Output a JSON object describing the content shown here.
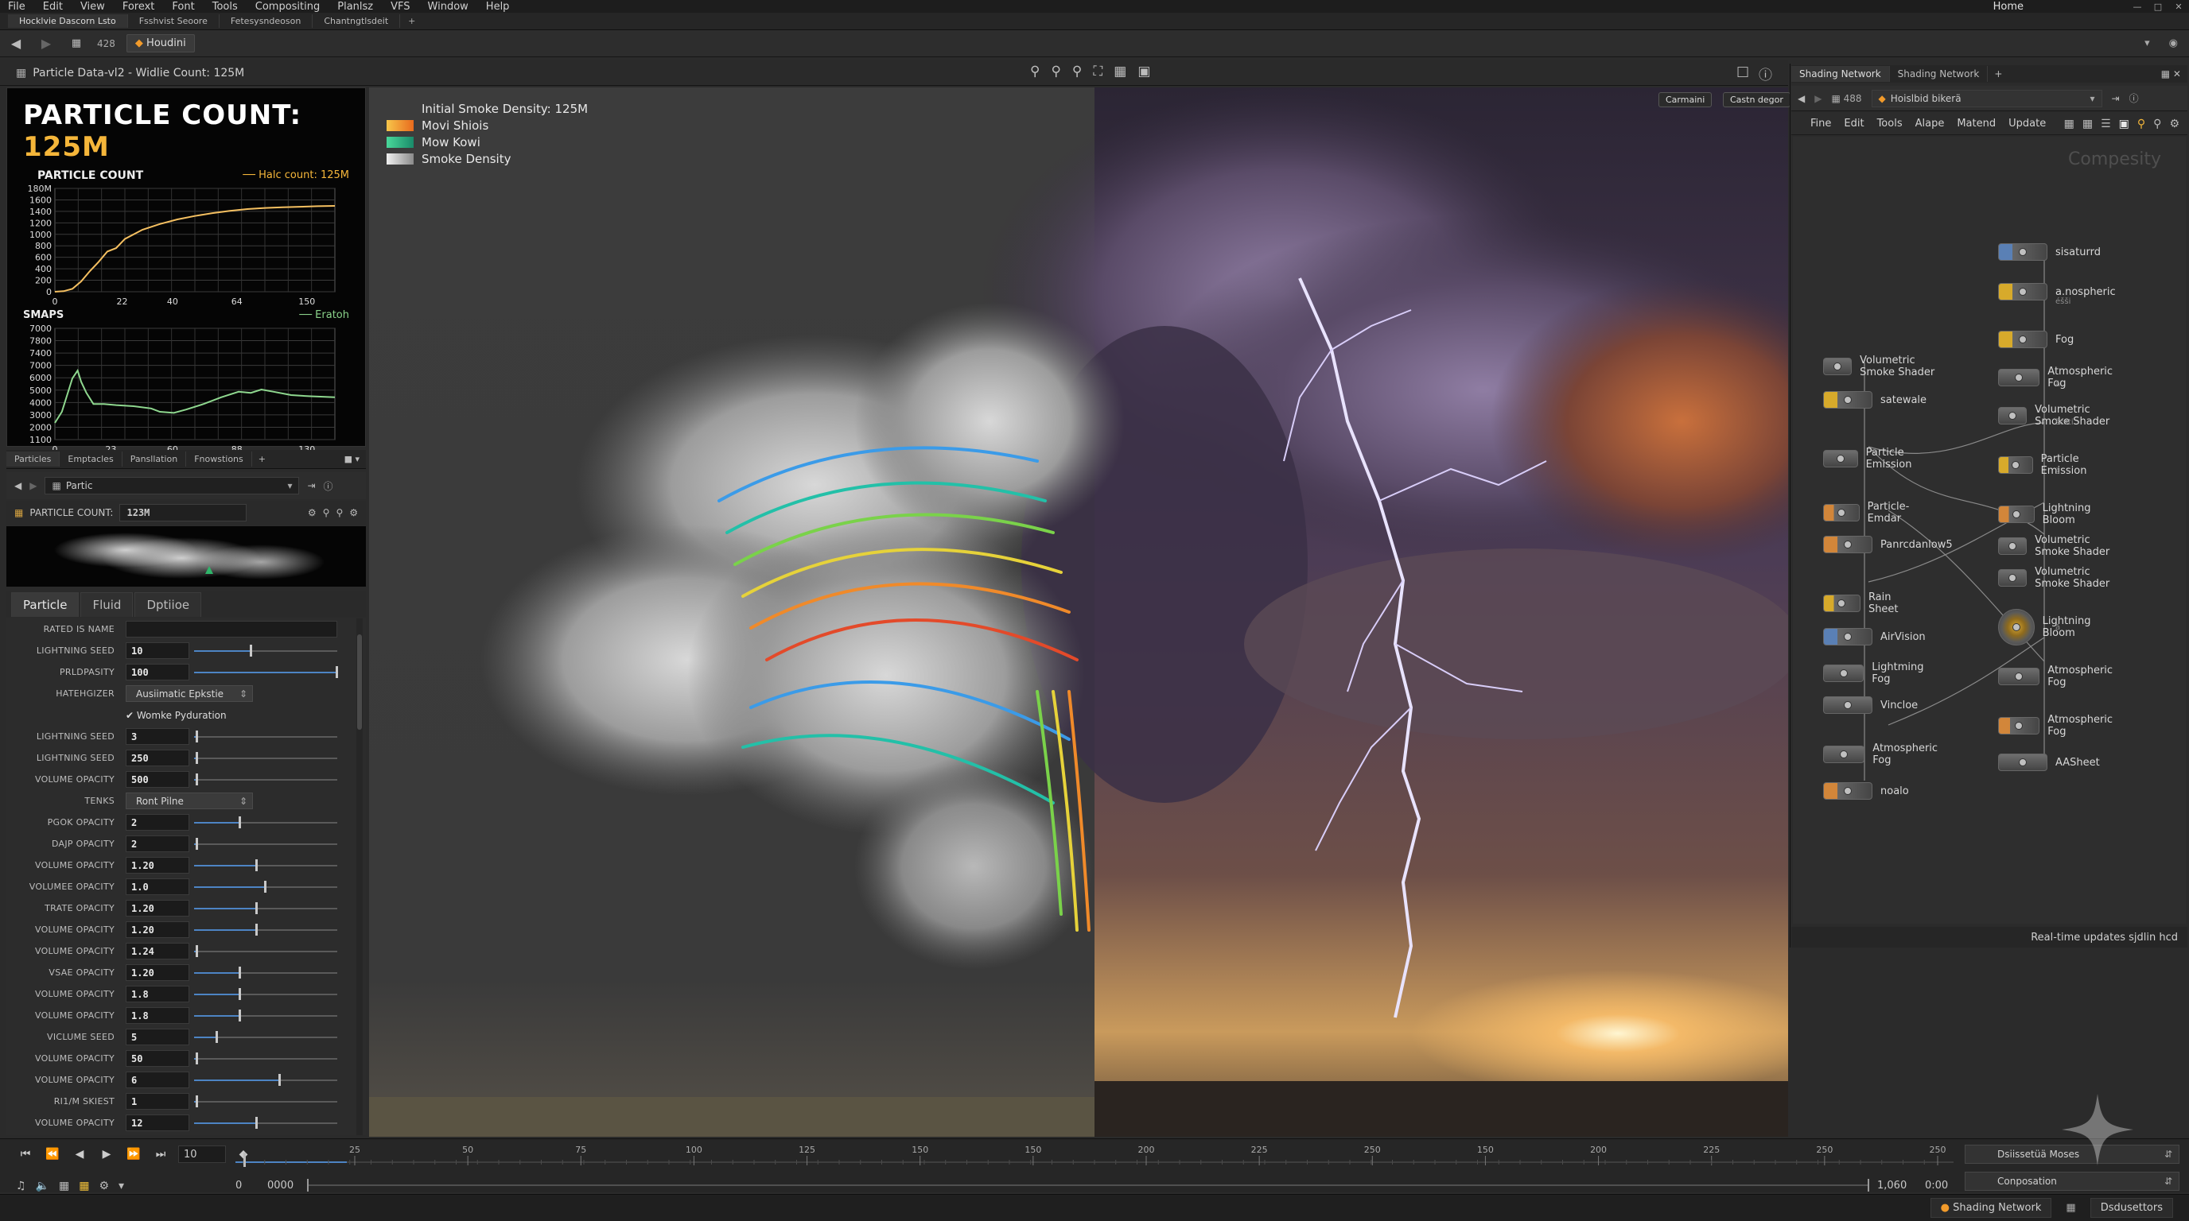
{
  "menubar": {
    "items": [
      "File",
      "Edit",
      "View",
      "Forext",
      "Font",
      "Tools",
      "Compositing",
      "Planlsz",
      "VFS",
      "Window",
      "Help"
    ],
    "desktop": "Home"
  },
  "tabstrip": {
    "tabs": [
      "Hocklvie Dascorn Lsto",
      "Fsshvist Seoore",
      "Fetesysndeoson",
      "Chantngtlsdeit"
    ]
  },
  "pathbar": {
    "node_chip": "428",
    "context_chip": "Houdini"
  },
  "viewport_header": {
    "title": "Particle Data-vl2 - Widlie Count:  125M"
  },
  "stats": {
    "heading_prefix": "PARTICLE COUNT:",
    "heading_value": "125M",
    "chart1": {
      "title": "PARTICLE COUNT",
      "legend": "Halc count: 125M"
    },
    "chart2": {
      "title": "SMAPS",
      "legend": "Eratoh"
    }
  },
  "chart_data": [
    {
      "type": "line",
      "title": "PARTICLE COUNT",
      "xlabel": "",
      "ylabel": "",
      "x_ticks": [
        "0",
        "22",
        "40",
        "64",
        "150"
      ],
      "y_ticks": [
        "0",
        "200",
        "400",
        "600",
        "800",
        "1000",
        "1200",
        "1400",
        "1600",
        "180M"
      ],
      "ylim": [
        0,
        1800
      ],
      "color": "#f5c061",
      "series": [
        {
          "name": "Halc count: 125M",
          "values": [
            [
              0,
              0
            ],
            [
              5,
              10
            ],
            [
              10,
              50
            ],
            [
              15,
              180
            ],
            [
              20,
              360
            ],
            [
              25,
              520
            ],
            [
              30,
              700
            ],
            [
              35,
              760
            ],
            [
              40,
              920
            ],
            [
              50,
              1080
            ],
            [
              60,
              1180
            ],
            [
              70,
              1260
            ],
            [
              80,
              1320
            ],
            [
              90,
              1370
            ],
            [
              100,
              1410
            ],
            [
              110,
              1440
            ],
            [
              120,
              1460
            ],
            [
              130,
              1470
            ],
            [
              140,
              1480
            ],
            [
              150,
              1490
            ],
            [
              160,
              1495
            ]
          ]
        }
      ],
      "xlim": [
        0,
        160
      ],
      "grid": true,
      "legend_position": "top-right"
    },
    {
      "type": "line",
      "title": "SMAPS",
      "xlabel": "",
      "ylabel": "",
      "x_ticks": [
        "0",
        "23",
        "60",
        "88",
        "130"
      ],
      "y_ticks": [
        "1100",
        "2000",
        "3000",
        "4000",
        "5000",
        "6000",
        "7000",
        "7400",
        "7800",
        "7000"
      ],
      "color": "#8fd88f",
      "series": [
        {
          "name": "Eratoh",
          "values": [
            [
              0,
              0.15
            ],
            [
              4,
              0.25
            ],
            [
              8,
              0.45
            ],
            [
              10,
              0.55
            ],
            [
              13,
              0.62
            ],
            [
              15,
              0.52
            ],
            [
              18,
              0.42
            ],
            [
              22,
              0.32
            ],
            [
              28,
              0.32
            ],
            [
              35,
              0.31
            ],
            [
              45,
              0.3
            ],
            [
              55,
              0.28
            ],
            [
              60,
              0.25
            ],
            [
              68,
              0.24
            ],
            [
              75,
              0.27
            ],
            [
              85,
              0.32
            ],
            [
              95,
              0.38
            ],
            [
              105,
              0.43
            ],
            [
              112,
              0.42
            ],
            [
              118,
              0.45
            ],
            [
              125,
              0.43
            ],
            [
              135,
              0.4
            ],
            [
              145,
              0.39
            ],
            [
              160,
              0.38
            ]
          ]
        }
      ],
      "xlim": [
        0,
        160
      ],
      "grid": true,
      "legend_position": "top-right"
    }
  ],
  "particles_panel": {
    "tabs": [
      "Particles",
      "Emptacles",
      "Pansllation",
      "Fnowstions"
    ],
    "path_value": "Partic",
    "count_label": "PARTICLE COUNT:",
    "count_value": "123M"
  },
  "param_tabs": [
    "Particle",
    "Fluid",
    "Dptiioe"
  ],
  "params": [
    {
      "label": "RATED IS NAME",
      "kind": "text",
      "value": ""
    },
    {
      "label": "LIGHTNING SEED",
      "kind": "num",
      "value": "10",
      "level": 0.4
    },
    {
      "label": "PRLDPASITY",
      "kind": "num",
      "value": "100",
      "level": 1.0
    },
    {
      "label": "HATEHGIZER",
      "kind": "menu",
      "value": "Ausiimatic Epkstie"
    },
    {
      "label": "",
      "kind": "check",
      "value": "Womke Pyduration"
    },
    {
      "label": "LIGHTNING SEED",
      "kind": "num",
      "value": "3",
      "level": 0.02
    },
    {
      "label": "LIGHTNING SEED",
      "kind": "num",
      "value": "250",
      "level": 0.02
    },
    {
      "label": "VOLUME OPACITY",
      "kind": "num",
      "value": "500",
      "level": 0.02
    },
    {
      "label": "TENKS",
      "kind": "menu",
      "value": "Ront Pilne"
    },
    {
      "label": "PGOK OPACITY",
      "kind": "num",
      "value": "2",
      "level": 0.32
    },
    {
      "label": "DAJP OPACITY",
      "kind": "num",
      "value": "2",
      "level": 0.02
    },
    {
      "label": "VOLUME OPACITY",
      "kind": "num",
      "value": "1.20",
      "level": 0.44
    },
    {
      "label": "VOLUMEE OPACITY",
      "kind": "num",
      "value": "1.0",
      "level": 0.5
    },
    {
      "label": "TRATE OPACITY",
      "kind": "num",
      "value": "1.20",
      "level": 0.44
    },
    {
      "label": "VOLUME OPACITY",
      "kind": "num",
      "value": "1.20",
      "level": 0.44
    },
    {
      "label": "VOLUME OPACITY",
      "kind": "num",
      "value": "1.24",
      "level": 0.02
    },
    {
      "label": "VSAE OPACITY",
      "kind": "num",
      "value": "1.20",
      "level": 0.32
    },
    {
      "label": "VOLUME OPACITY",
      "kind": "num",
      "value": "1.8",
      "level": 0.32
    },
    {
      "label": "VOLUME OPACITY",
      "kind": "num",
      "value": "1.8",
      "level": 0.32
    },
    {
      "label": "VICLUME SEED",
      "kind": "num",
      "value": "5",
      "level": 0.16
    },
    {
      "label": "VOLUME OPACITY",
      "kind": "num",
      "value": "50",
      "level": 0.02
    },
    {
      "label": "VOLUME OPACITY",
      "kind": "num",
      "value": "6",
      "level": 0.6
    },
    {
      "label": "RI1/M SKIEST",
      "kind": "num",
      "value": "1",
      "level": 0.02
    },
    {
      "label": "VOLUME OPACITY",
      "kind": "num",
      "value": "12",
      "level": 0.44
    }
  ],
  "viewport": {
    "legend": [
      {
        "label": "Initial Smoke Density: 125M",
        "color": ""
      },
      {
        "label": "Movi Shiois",
        "color": "#f0a020"
      },
      {
        "label": "Mow Kowi",
        "color": "#22c08a"
      },
      {
        "label": "Smoke Density",
        "color": "#cfcfcf"
      }
    ],
    "btn_camera": "Carmaini",
    "btn_display": "Castn degor"
  },
  "network": {
    "tabs": [
      "Shading Network",
      "Shading Network"
    ],
    "path_chip": "488",
    "path_value": "Hoislbid bikerä",
    "menu": [
      "Fine",
      "Edit",
      "Tools",
      "Alape",
      "Matend",
      "Update"
    ],
    "watermark": "Compesity",
    "status": "Real-time updates sjdlin hcd",
    "nodes_left": [
      {
        "label": "Volumetric Smoke Shader",
        "color": "gray",
        "sub": ""
      },
      {
        "label": "satewale",
        "color": "yellow",
        "sub": ""
      },
      {
        "label": "Particle Emission",
        "color": "gray",
        "sub": ""
      },
      {
        "label": "Particle-Emdar",
        "color": "orange",
        "sub": ""
      },
      {
        "label": "Panrcdanlow5",
        "color": "orange",
        "sub": ""
      },
      {
        "label": "Rain Sheet",
        "color": "yellow",
        "sub": ""
      },
      {
        "label": "AirVision",
        "color": "blue",
        "sub": ""
      },
      {
        "label": "Lightming Fog",
        "color": "gray",
        "sub": ""
      },
      {
        "label": "Vincloe",
        "color": "gray",
        "sub": ""
      },
      {
        "label": "Atmospheric Fog",
        "color": "gray",
        "sub": ""
      },
      {
        "label": "noalo",
        "color": "orange",
        "sub": ""
      }
    ],
    "nodes_right": [
      {
        "label": "sisaturrd",
        "color": "blue",
        "sub": ""
      },
      {
        "label": "a.nospheric",
        "color": "yellow",
        "sub": "éšši"
      },
      {
        "label": "Fog",
        "color": "yellow",
        "sub": ""
      },
      {
        "label": "Atmospheric Fog",
        "color": "gray",
        "sub": "ă"
      },
      {
        "label": "Volumetric Smoke Shader",
        "color": "gray",
        "sub": "šcsti"
      },
      {
        "label": "Particle Emission",
        "color": "yellow",
        "sub": "š"
      },
      {
        "label": "Lightning Bloom",
        "color": "orange",
        "sub": ""
      },
      {
        "label": "Volumetric Smoke Shader",
        "color": "gray",
        "sub": ""
      },
      {
        "label": "Volumetric Smoke Shader",
        "color": "gray",
        "sub": ""
      },
      {
        "label": "Lightning Bloom",
        "color": "round",
        "sub": "ă"
      },
      {
        "label": "Atmospheric Fog",
        "color": "gray",
        "sub": ""
      },
      {
        "label": "Atmospheric Fog",
        "color": "orange",
        "sub": ""
      },
      {
        "label": "AASheet",
        "color": "gray",
        "sub": ""
      }
    ]
  },
  "timeline": {
    "frame": "10",
    "ticks": [
      "25",
      "50",
      "75",
      "100",
      "125",
      "150",
      "150",
      "200",
      "225",
      "250",
      "150",
      "200",
      "225",
      "250",
      "250"
    ],
    "range_start": "0",
    "range_start2": "0000",
    "range_end": "1,060",
    "time": "0:00",
    "dropdown1": "Dsiissetüä Moses",
    "dropdown2": "Conposation"
  },
  "statusbar": {
    "item1": "Shading Network",
    "item2": "Dsdusettors"
  }
}
